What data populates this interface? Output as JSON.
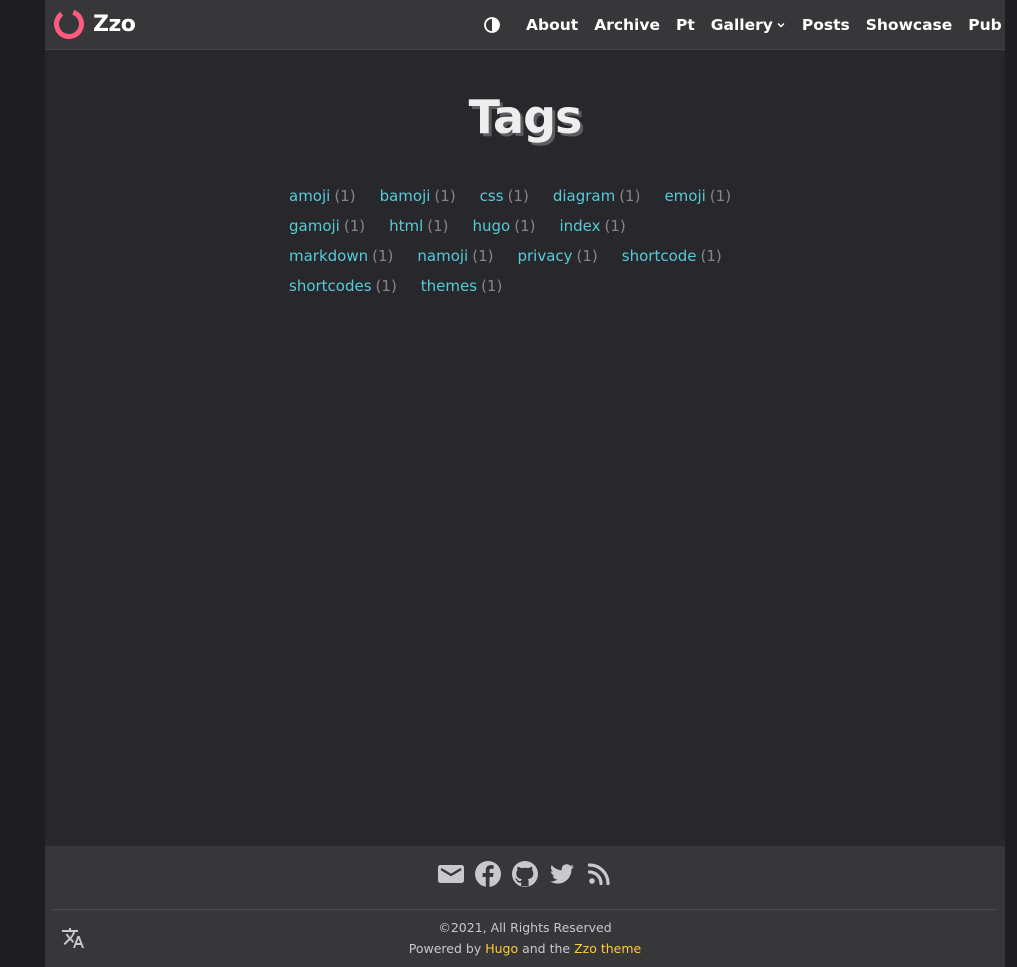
{
  "brand": {
    "name": "Zzo",
    "accent": "#ff5b7f"
  },
  "nav": {
    "theme_toggle_icon": "contrast-icon",
    "items": [
      {
        "label": "About"
      },
      {
        "label": "Archive"
      },
      {
        "label": "Pt"
      },
      {
        "label": "Gallery",
        "has_dropdown": true
      },
      {
        "label": "Posts"
      },
      {
        "label": "Showcase"
      },
      {
        "label": "Pub"
      }
    ]
  },
  "main": {
    "title": "Tags",
    "tags": [
      {
        "name": "amoji",
        "count": "(1)"
      },
      {
        "name": "bamoji",
        "count": "(1)"
      },
      {
        "name": "css",
        "count": "(1)"
      },
      {
        "name": "diagram",
        "count": "(1)"
      },
      {
        "name": "emoji",
        "count": "(1)"
      },
      {
        "name": "gamoji",
        "count": "(1)"
      },
      {
        "name": "html",
        "count": "(1)"
      },
      {
        "name": "hugo",
        "count": "(1)"
      },
      {
        "name": "index",
        "count": "(1)"
      },
      {
        "name": "markdown",
        "count": "(1)"
      },
      {
        "name": "namoji",
        "count": "(1)"
      },
      {
        "name": "privacy",
        "count": "(1)"
      },
      {
        "name": "shortcode",
        "count": "(1)"
      },
      {
        "name": "shortcodes",
        "count": "(1)"
      },
      {
        "name": "themes",
        "count": "(1)"
      }
    ]
  },
  "footer": {
    "socials": [
      "email-icon",
      "facebook-icon",
      "github-icon",
      "twitter-icon",
      "rss-icon"
    ],
    "copyright": "©2021, All Rights Reserved",
    "powered_by": "Powered by",
    "hugo_link": "Hugo",
    "and_the": "and the",
    "theme_link": "Zzo theme",
    "language_icon": "translate-icon"
  },
  "colors": {
    "background": "#28272b",
    "navbar": "#373639",
    "tag_link": "#56cbd9",
    "footer_link": "#ffcc33"
  }
}
